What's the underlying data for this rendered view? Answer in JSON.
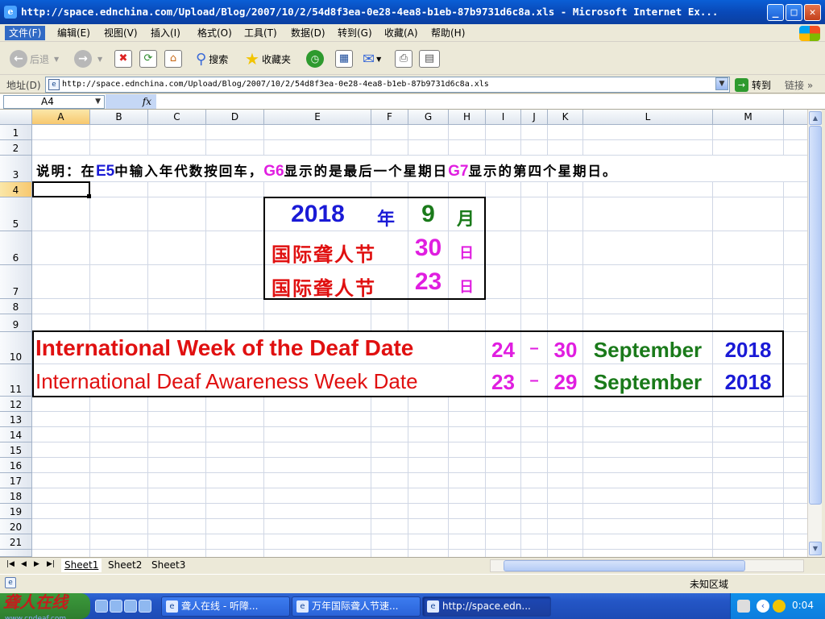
{
  "window": {
    "title": "http://space.ednchina.com/Upload/Blog/2007/10/2/54d8f3ea-0e28-4ea8-b1eb-87b9731d6c8a.xls - Microsoft Internet Ex...",
    "minimize_glyph": "_",
    "maximize_glyph": "□",
    "close_glyph": "✕"
  },
  "menu": {
    "items": [
      "文件(F)",
      "编辑(E)",
      "视图(V)",
      "插入(I)",
      "格式(O)",
      "工具(T)",
      "数据(D)",
      "转到(G)",
      "收藏(A)",
      "帮助(H)"
    ]
  },
  "toolbar": {
    "back_label": "后退",
    "search_label": "搜索",
    "favorites_label": "收藏夹"
  },
  "address": {
    "label": "地址(D)",
    "url": "http://space.ednchina.com/Upload/Blog/2007/10/2/54d8f3ea-0e28-4ea8-b1eb-87b9731d6c8a.xls",
    "go_label": "转到",
    "links_label": "链接"
  },
  "formula": {
    "name_box": "A4",
    "fx": "fx",
    "content": ""
  },
  "sheet": {
    "columns": [
      "A",
      "B",
      "C",
      "D",
      "E",
      "F",
      "G",
      "H",
      "I",
      "J",
      "K",
      "L",
      "M"
    ],
    "rows": [
      "1",
      "2",
      "3",
      "4",
      "5",
      "6",
      "7",
      "8",
      "9",
      "10",
      "11",
      "12",
      "13",
      "14",
      "15",
      "16",
      "17",
      "18",
      "19",
      "20",
      "21"
    ],
    "selected_cell": "A4",
    "note": {
      "p1": "说明：在",
      "ref1": "E5",
      "p2": "中输入年代数按回车，",
      "ref2": "G6",
      "p3": "显示的是最后一个星期日",
      "ref3": "G7",
      "p4": "显示的第四个星期日。"
    },
    "date_box": {
      "year": "2018",
      "year_unit": "年",
      "month": "9",
      "month_unit": "月",
      "label_row6": "国际聋人节",
      "day_row6": "30",
      "day_unit_row6": "日",
      "label_row7": "国际聋人节",
      "day_row7": "23",
      "day_unit_row7": "日"
    },
    "english_box": {
      "row10_label": "International Week of the Deaf Date",
      "row10_start": "24",
      "row10_dash": "–",
      "row10_end": "30",
      "row10_month": "September",
      "row10_year": "2018",
      "row11_label": "International Deaf Awareness Week Date",
      "row11_start": "23",
      "row11_dash": "–",
      "row11_end": "29",
      "row11_month": "September",
      "row11_year": "2018"
    },
    "tabs": [
      "Sheet1",
      "Sheet2",
      "Sheet3"
    ],
    "active_tab": "Sheet1"
  },
  "status": {
    "zone": "未知区域"
  },
  "taskbar": {
    "start_label": "聋人在线",
    "start_sub": "www.cndeaf.com",
    "buttons": [
      "聋人在线 - 听障...",
      "万年国际聋人节速...",
      "http://space.edn..."
    ],
    "clock": "0:04"
  },
  "colors": {
    "blue": "#1a1ad6",
    "green": "#1a7a1a",
    "magenta": "#e01ee0",
    "red": "#e01010",
    "xp_blue": "#0a5fd6"
  }
}
